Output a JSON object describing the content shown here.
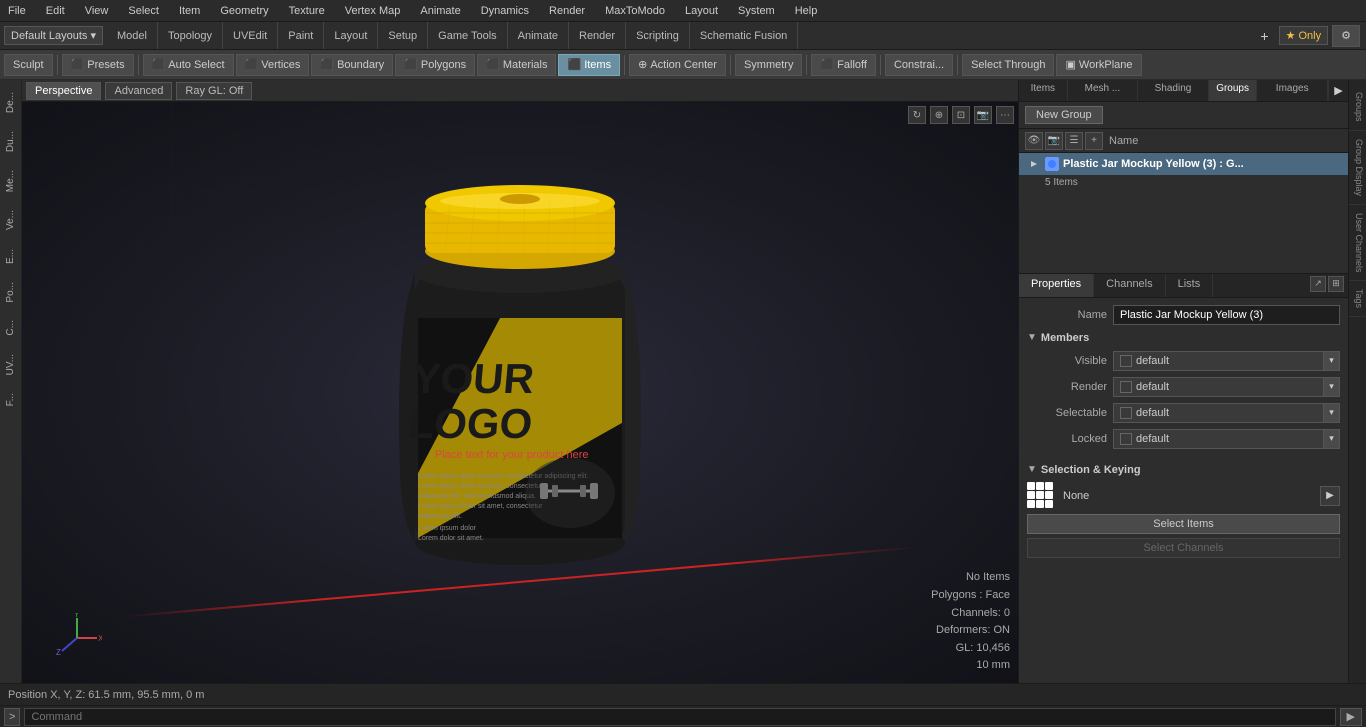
{
  "menubar": {
    "items": [
      "File",
      "Edit",
      "View",
      "Select",
      "Item",
      "Geometry",
      "Texture",
      "Vertex Map",
      "Animate",
      "Dynamics",
      "Render",
      "MaxToModo",
      "Layout",
      "System",
      "Help"
    ]
  },
  "layout_selector": "Default Layouts ▾",
  "layout_tabs": [
    "Model",
    "Topology",
    "UVEdit",
    "Paint",
    "Layout",
    "Setup",
    "Game Tools",
    "Animate",
    "Render",
    "Scripting",
    "Schematic Fusion"
  ],
  "layout_plus": "+",
  "layout_only": "★ Only",
  "layout_settings": "⚙",
  "toolbar": {
    "sculpt": "Sculpt",
    "presets": "Presets",
    "auto_select": "Auto Select",
    "vertices": "Vertices",
    "boundary": "Boundary",
    "polygons": "Polygons",
    "materials": "Materials",
    "items": "Items",
    "action_center": "Action Center",
    "symmetry": "Symmetry",
    "falloff": "Falloff",
    "constraints": "Constrai...",
    "select_through": "Select Through",
    "workplane": "WorkPlane"
  },
  "left_tabs": [
    "De...",
    "Du...",
    "Me...",
    "Ve...",
    "E...",
    "Po...",
    "C...",
    "UV...",
    "F..."
  ],
  "viewport": {
    "perspective": "Perspective",
    "advanced": "Advanced",
    "ray_gl": "Ray GL: Off",
    "no_items": "No Items",
    "polygons_face": "Polygons : Face",
    "channels": "Channels: 0",
    "deformers": "Deformers: ON",
    "gl": "GL: 10,456",
    "mm": "10 mm"
  },
  "right_panel": {
    "top_tabs": [
      "Items",
      "Mesh ...",
      "Shading",
      "Groups",
      "Images"
    ],
    "new_group_btn": "New Group",
    "toolbar_icons": [
      "●",
      "●",
      "☰",
      "+"
    ],
    "name_col": "Name",
    "group_name": "Plastic Jar Mockup Yellow (3) : G...",
    "group_name_short": "Plastic Jar Mockup Yellow (3)",
    "group_sub": "5 Items",
    "props_tabs": [
      "Properties",
      "Channels",
      "Lists"
    ],
    "name_label": "Name",
    "name_value": "Plastic Jar Mockup Yellow (3)",
    "members_label": "Members",
    "visible_label": "Visible",
    "visible_value": "default",
    "render_label": "Render",
    "render_value": "default",
    "selectable_label": "Selectable",
    "selectable_value": "default",
    "locked_label": "Locked",
    "locked_value": "default",
    "sel_keying_label": "Selection & Keying",
    "none_label": "None",
    "select_items_btn": "Select Items",
    "select_channels_btn": "Select Channels"
  },
  "right_vtabs": [
    "Groups",
    "Group Display",
    "User Channels",
    "Tags"
  ],
  "status_bar": {
    "position": "Position X, Y, Z:  61.5 mm, 95.5 mm, 0 m"
  },
  "command_bar": {
    "expand": ">",
    "placeholder": "Command",
    "go_btn": "▶"
  }
}
